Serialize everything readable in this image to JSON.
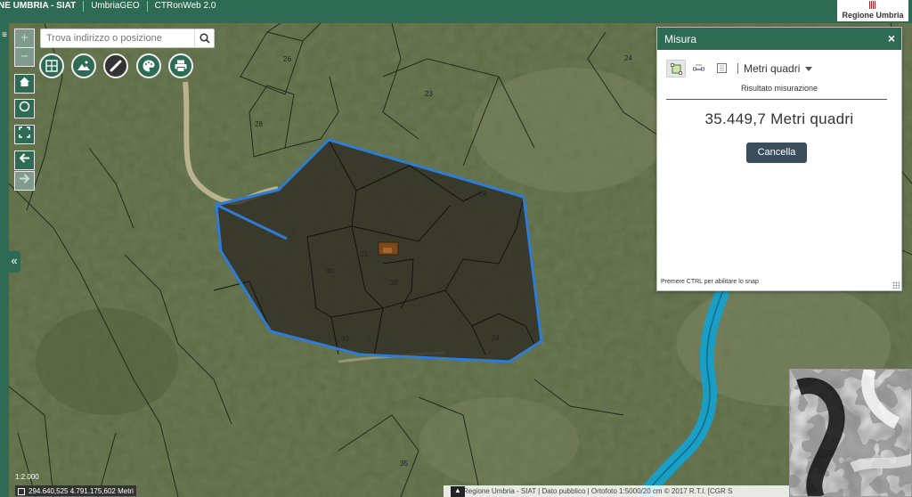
{
  "header": {
    "tabs": [
      "NE UMBRIA - SIAT",
      "UmbriaGEO",
      "CTRonWeb 2.0"
    ],
    "region_label": "Regione Umbria"
  },
  "search": {
    "placeholder": "Trova indirizzo o posizione"
  },
  "nav": {
    "zoom_in": "+",
    "zoom_out": "−",
    "collapse": "«"
  },
  "toolbar": {
    "tools": [
      "layers-icon",
      "basemap-icon",
      "ruler-icon",
      "palette-icon",
      "print-icon"
    ],
    "active_tool": "ruler-icon"
  },
  "measure_panel": {
    "title": "Misura",
    "close_label": "×",
    "unit": "Metri quadri",
    "result_label": "Risultato misurazione",
    "result_value": "35.449,7 Metri quadri",
    "cancel_label": "Cancella",
    "snap_hint": "Premere CTRL per abilitare lo snap"
  },
  "map": {
    "parcel_numbers": [
      "26",
      "23",
      "24",
      "28",
      "29",
      "30",
      "31",
      "32",
      "33",
      "34",
      "35"
    ],
    "polygon_color": "#2d7cd6",
    "river_color": "#1a9ec4"
  },
  "footer": {
    "scale": "1:2.000",
    "coordinates": "294.640,525 4.791.175,602 Metri",
    "attribution": "Regione Umbria - SIAT | Dato pubblico | Ortofoto 1:5000/20 cm © 2017 R.T.I. [CGR S"
  },
  "colors": {
    "brand": "#2e6b55",
    "cancel_button": "#3a4d5c"
  }
}
